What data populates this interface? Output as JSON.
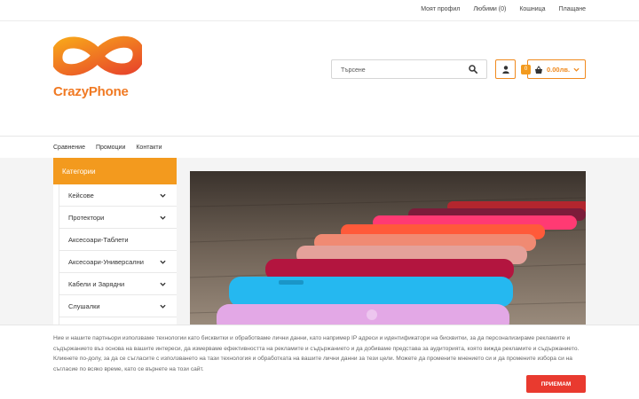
{
  "topbar": {
    "links": [
      "Моят профил",
      "Любими (0)",
      "Кошница",
      "Плащане"
    ]
  },
  "logo": {
    "brand": "CrazyPhone"
  },
  "search": {
    "placeholder": "Търсене",
    "icon": "search-icon"
  },
  "user": {
    "icon": "user-icon"
  },
  "cart": {
    "count": "0",
    "total": "0.00лв.",
    "icon": "basket-icon"
  },
  "nav": {
    "links": [
      "Сравнение",
      "Промоции",
      "Контакти"
    ]
  },
  "sidebar": {
    "title": "Категории",
    "items": [
      {
        "label": "Кейсове",
        "has_children": true
      },
      {
        "label": "Протектори",
        "has_children": true
      },
      {
        "label": "Аксесоари-Таблети",
        "has_children": false
      },
      {
        "label": "Аксесоари-Универсални",
        "has_children": true
      },
      {
        "label": "Кабели и Зарядни",
        "has_children": true
      },
      {
        "label": "Слушалки",
        "has_children": true
      },
      {
        "label": "",
        "has_children": false
      }
    ]
  },
  "cookie": {
    "text": "Ние и нашите партньори използваме технологии като бисквитки и обработваме лични данни, като например IP адреси и идентификатори на бисквитки, за да персонализираме рекламите и съдържанието въз основа на вашите интереси, да измерваме ефективността на рекламите и съдържанието и да добиваме представа за аудиторията, която вижда рекламите и съдържанието. Кликнете по-долу, за да се съгласите с използването на тази технология и обработката на вашите лични данни за тези цели. Можете да промените мнението си и да промените избора си на съгласие по всяко време, като се върнете на този сайт.",
    "accept_label": "ПРИЕМАМ"
  },
  "colors": {
    "accent": "#f39a1e",
    "accept": "#e93a2f"
  }
}
